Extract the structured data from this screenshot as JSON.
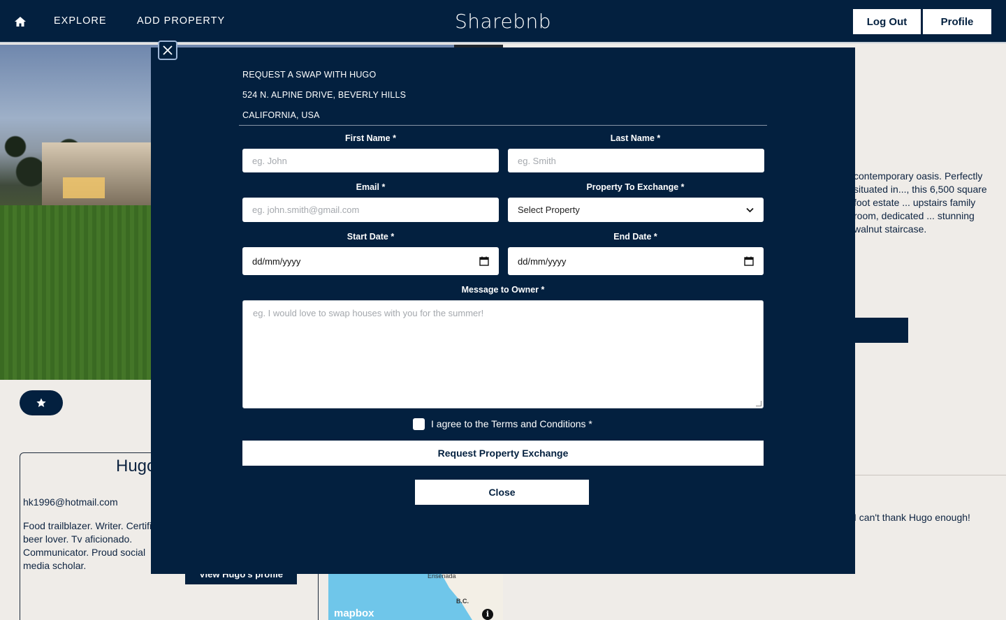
{
  "navbar": {
    "home_icon": "home-icon",
    "explore": "EXPLORE",
    "add_property": "ADD PROPERTY",
    "brand": "Sharebnb",
    "logout": "Log Out",
    "profile": "Profile"
  },
  "background": {
    "owner_name": "Hugo",
    "owner_email": "hk1996@hotmail.com",
    "owner_bio": "Food trailblazer. Writer. Certified beer lover. Tv aficionado. Communicator. Proud social media scholar.",
    "view_profile": "View Hugo's profile",
    "description": "contemporary oasis. Perfectly situated in..., this 6,500 square foot estate ... upstairs family room, dedicated ... stunning walnut staircase.",
    "review": "I can't thank Hugo enough!",
    "map_label_city": "Ensenada",
    "map_label_region": "B.C.",
    "map_logo": "mapbox"
  },
  "modal": {
    "heading_line1": "REQUEST A SWAP WITH HUGO",
    "heading_line2": "524 N. ALPINE DRIVE, BEVERLY HILLS",
    "heading_line3": "CALIFORNIA, USA",
    "first_name_label": "First Name *",
    "first_name_placeholder": "eg. John",
    "last_name_label": "Last Name *",
    "last_name_placeholder": "eg. Smith",
    "email_label": "Email *",
    "email_placeholder": "eg. john.smith@gmail.com",
    "property_label": "Property To Exchange *",
    "property_selected": "Select Property",
    "start_label": "Start Date *",
    "start_value": "dd/mm/yyyy",
    "end_label": "End Date *",
    "end_value": "dd/mm/yyyy",
    "message_label": "Message to Owner *",
    "message_placeholder": "eg. I would love to swap houses with you for the summer!",
    "terms_label": "I agree to the Terms and Conditions *",
    "submit": "Request Property Exchange",
    "close": "Close"
  },
  "colors": {
    "primary_navy": "#03203f",
    "page_bg": "#efece8",
    "white": "#ffffff"
  }
}
